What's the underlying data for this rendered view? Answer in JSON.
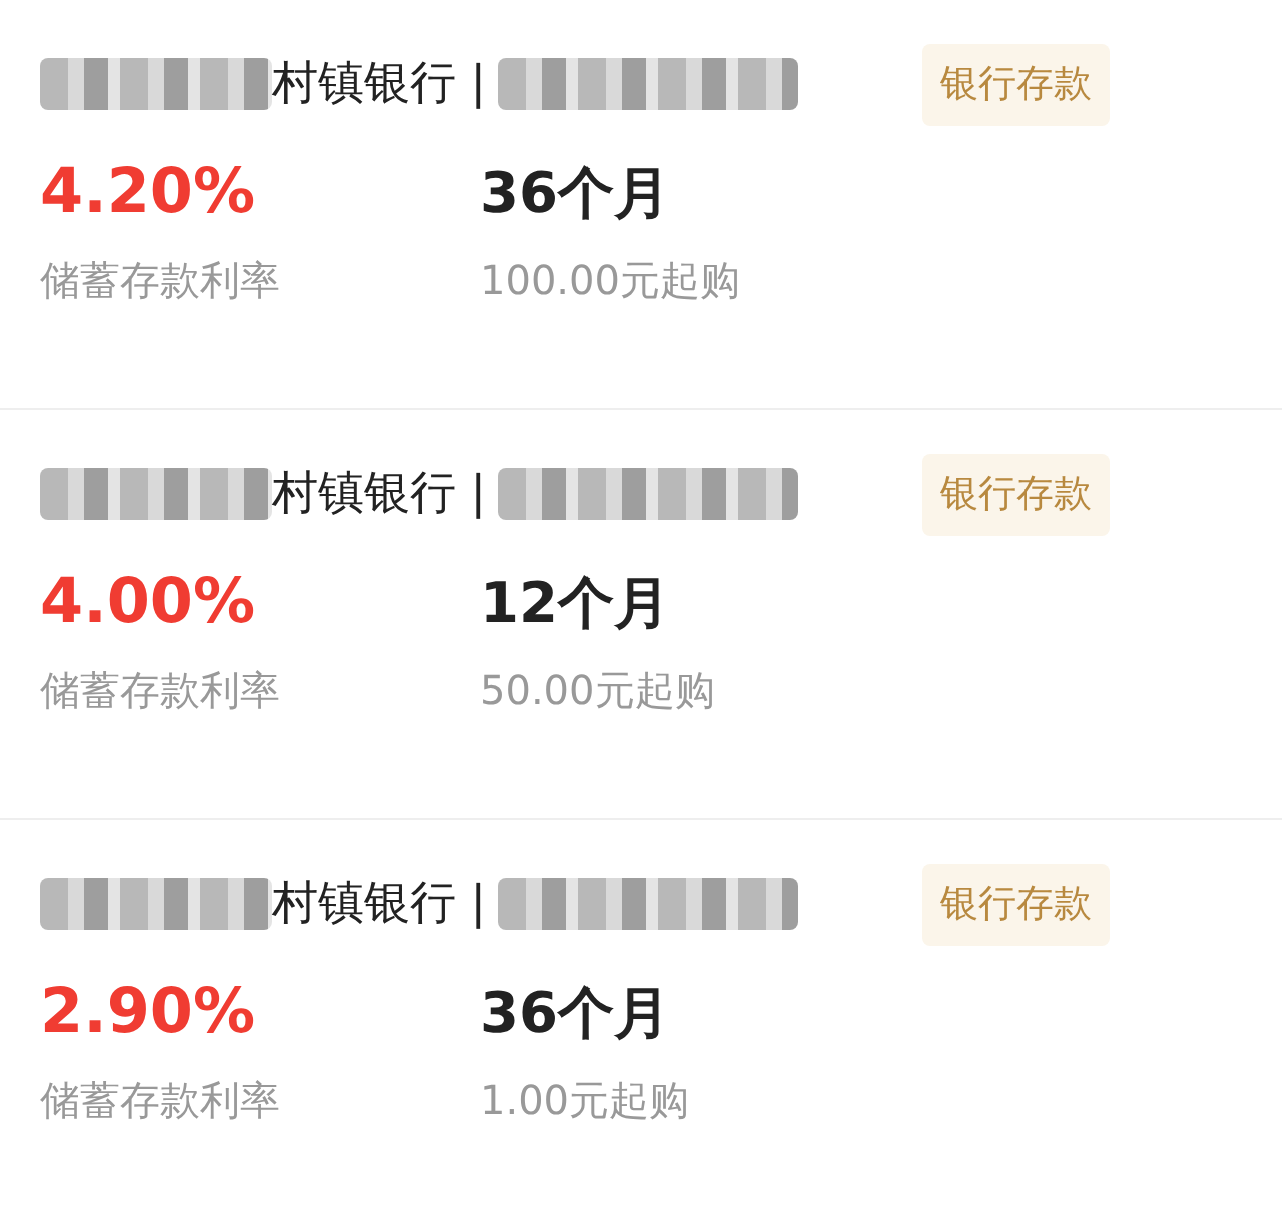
{
  "products": [
    {
      "bank_name": "村镇银行 |",
      "tag": "银行存款",
      "rate": "4.20%",
      "rate_label": "储蓄存款利率",
      "term": "36个月",
      "minimum": "100.00元起购"
    },
    {
      "bank_name": "村镇银行 |",
      "tag": "银行存款",
      "rate": "4.00%",
      "rate_label": "储蓄存款利率",
      "term": "12个月",
      "minimum": "50.00元起购"
    },
    {
      "bank_name": "村镇银行 |",
      "tag": "银行存款",
      "rate": "2.90%",
      "rate_label": "储蓄存款利率",
      "term": "36个月",
      "minimum": "1.00元起购"
    }
  ]
}
